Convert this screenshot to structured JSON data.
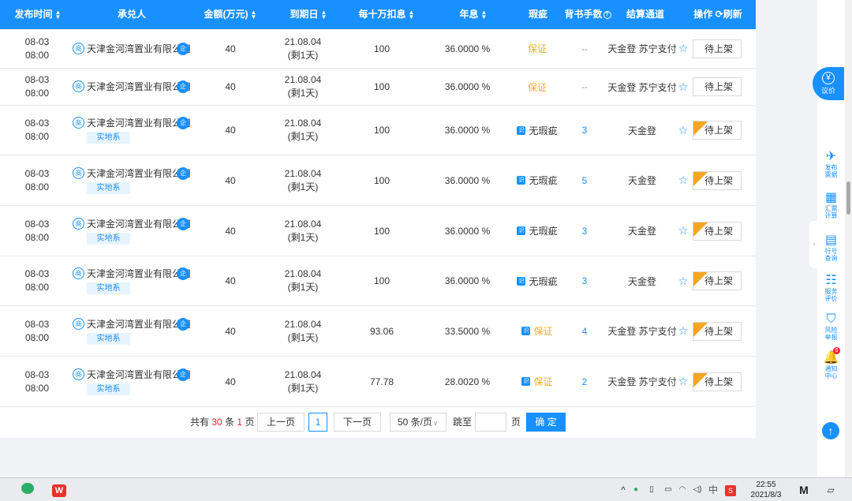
{
  "header": {
    "time": "发布时间",
    "acceptor": "承兑人",
    "amount": "金额(万元)",
    "due": "到期日",
    "discount": "每十万扣息",
    "rate": "年息",
    "flaw": "瑕疵",
    "endorse": "背书手数",
    "endorse_help": "?",
    "channel": "结算通道",
    "op": "操作",
    "refresh_icon": "⟳",
    "refresh": "刷新"
  },
  "badges": {
    "shang": "商",
    "qi": "企",
    "sq": "识"
  },
  "rows": [
    {
      "date": "08-03",
      "time": "08:00",
      "acceptor": "天津金河湾置业有限公司",
      "tag": "",
      "amount": "40",
      "due": "21.08.04",
      "remain": "(剩1天)",
      "discount": "100",
      "rate": "36.0000 %",
      "flaw": "保证",
      "flaw_type": "yellow",
      "endorse": "--",
      "channel": "天金登 苏宁支付",
      "star": "☆",
      "btn": "待上架",
      "corner": false
    },
    {
      "date": "08-03",
      "time": "08:00",
      "acceptor": "天津金河湾置业有限公司",
      "tag": "",
      "amount": "40",
      "due": "21.08.04",
      "remain": "(剩1天)",
      "discount": "100",
      "rate": "36.0000 %",
      "flaw": "保证",
      "flaw_type": "yellow",
      "endorse": "--",
      "channel": "天金登 苏宁支付",
      "star": "☆",
      "btn": "待上架",
      "corner": false
    },
    {
      "date": "08-03",
      "time": "08:00",
      "acceptor": "天津金河湾置业有限公司",
      "tag": "实地系",
      "amount": "40",
      "due": "21.08.04",
      "remain": "(剩1天)",
      "discount": "100",
      "rate": "36.0000 %",
      "flaw": "无瑕疵",
      "flaw_type": "plain",
      "endorse": "3",
      "channel": "天金登",
      "star": "☆",
      "btn": "待上架",
      "corner": true
    },
    {
      "date": "08-03",
      "time": "08:00",
      "acceptor": "天津金河湾置业有限公司",
      "tag": "实地系",
      "amount": "40",
      "due": "21.08.04",
      "remain": "(剩1天)",
      "discount": "100",
      "rate": "36.0000 %",
      "flaw": "无瑕疵",
      "flaw_type": "plain",
      "endorse": "5",
      "channel": "天金登",
      "star": "☆",
      "btn": "待上架",
      "corner": true
    },
    {
      "date": "08-03",
      "time": "08:00",
      "acceptor": "天津金河湾置业有限公司",
      "tag": "实地系",
      "amount": "40",
      "due": "21.08.04",
      "remain": "(剩1天)",
      "discount": "100",
      "rate": "36.0000 %",
      "flaw": "无瑕疵",
      "flaw_type": "plain",
      "endorse": "3",
      "channel": "天金登",
      "star": "☆",
      "btn": "待上架",
      "corner": true
    },
    {
      "date": "08-03",
      "time": "08:00",
      "acceptor": "天津金河湾置业有限公司",
      "tag": "实地系",
      "amount": "40",
      "due": "21.08.04",
      "remain": "(剩1天)",
      "discount": "100",
      "rate": "36.0000 %",
      "flaw": "无瑕疵",
      "flaw_type": "plain",
      "endorse": "3",
      "channel": "天金登",
      "star": "☆",
      "btn": "待上架",
      "corner": true
    },
    {
      "date": "08-03",
      "time": "08:00",
      "acceptor": "天津金河湾置业有限公司",
      "tag": "实地系",
      "amount": "40",
      "due": "21.08.04",
      "remain": "(剩1天)",
      "discount": "93.06",
      "rate": "33.5000 %",
      "flaw": "保证",
      "flaw_type": "yellow-sq",
      "endorse": "4",
      "channel": "天金登 苏宁支付",
      "star": "☆",
      "btn": "待上架",
      "corner": true
    },
    {
      "date": "08-03",
      "time": "08:00",
      "acceptor": "天津金河湾置业有限公司",
      "tag": "实地系",
      "amount": "40",
      "due": "21.08.04",
      "remain": "(剩1天)",
      "discount": "77.78",
      "rate": "28.0020 %",
      "flaw": "保证",
      "flaw_type": "yellow-sq",
      "endorse": "2",
      "channel": "天金登 苏宁支付",
      "star": "☆",
      "btn": "待上架",
      "corner": true
    }
  ],
  "pager": {
    "total_prefix": "共有",
    "total_count": "30",
    "total_mid": "条",
    "total_pages": "1",
    "total_suffix": "页",
    "prev": "上一页",
    "current": "1",
    "next": "下一页",
    "page_size": "50 条/页",
    "jump_label": "跳至",
    "jump_value": "",
    "page_unit": "页",
    "confirm": "确 定"
  },
  "sidebar": {
    "yijia": "议价",
    "yijia_icon": "¥",
    "items": [
      {
        "icon": "✈",
        "label1": "发布",
        "label2": "票据"
      },
      {
        "icon": "▦",
        "label1": "汇票",
        "label2": "计算"
      },
      {
        "icon": "▤",
        "label1": "行号",
        "label2": "查询"
      },
      {
        "icon": "☷",
        "label1": "服务",
        "label2": "评价"
      },
      {
        "icon": "⛉",
        "label1": "风险",
        "label2": "举报"
      },
      {
        "icon": "🔔",
        "label1": "通知",
        "label2": "中心"
      }
    ],
    "notify_count": "6",
    "back_top": "↑",
    "collapse": "›"
  },
  "taskbar": {
    "tray": "^",
    "ime": "中",
    "time": "22:55",
    "date": "2021/8/3",
    "wps_letter": "W",
    "m_letter": "M"
  }
}
